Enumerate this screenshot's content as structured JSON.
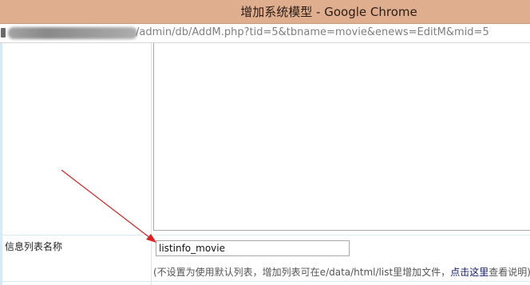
{
  "window": {
    "title": "增加系统模型 - Google Chrome"
  },
  "address_bar": {
    "url_visible": "/admin/db/AddM.php?tid=5&tbname=movie&enews=EditM&mid=5"
  },
  "form": {
    "list_template_label": "信息列表名称",
    "list_template_value": "listinfo_movie",
    "hint_prefix": "(不设置为使用默认列表，增加列表可在e/data/html/list里增加文件，",
    "hint_link": "点击这里",
    "hint_suffix": "查看说明)"
  },
  "annotation": {
    "arrow_color": "#e02020",
    "icon": "red-arrow-icon"
  },
  "colors": {
    "titlebar": "#dfae8f",
    "rail": "#d7e9f5",
    "link": "#111a66"
  }
}
